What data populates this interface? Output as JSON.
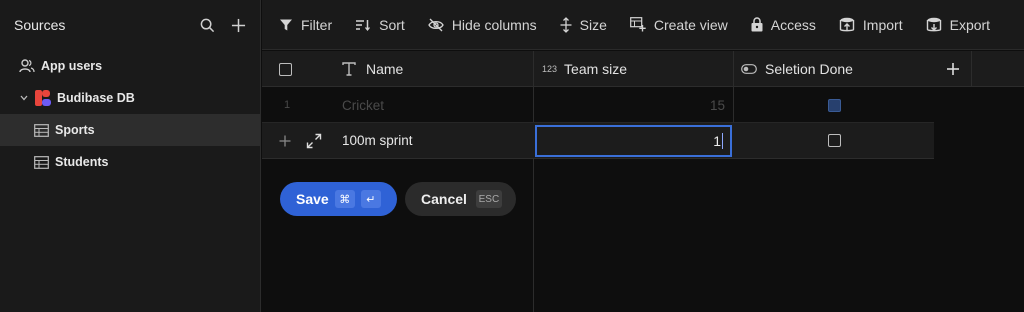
{
  "sidebar": {
    "title": "Sources",
    "items": [
      {
        "label": "App users",
        "icon": "users-icon"
      },
      {
        "label": "Budibase DB",
        "icon": "budibase-logo-icon"
      },
      {
        "label": "Sports",
        "icon": "table-icon"
      },
      {
        "label": "Students",
        "icon": "table-icon"
      }
    ]
  },
  "toolbar": {
    "filter": "Filter",
    "sort": "Sort",
    "hide_columns": "Hide columns",
    "size": "Size",
    "create_view": "Create view",
    "access": "Access",
    "import": "Import",
    "export": "Export"
  },
  "grid": {
    "columns": [
      {
        "label": "Name",
        "type_icon": "text-type-icon"
      },
      {
        "label": "Team size",
        "type_icon": "number-type-icon",
        "type_text": "123"
      },
      {
        "label": "Seletion Done",
        "type_icon": "toggle-type-icon"
      }
    ],
    "rows": [
      {
        "index": "1",
        "name": "Cricket",
        "team_size": "15",
        "selection_done": true
      },
      {
        "name": "100m sprint",
        "team_size": "1",
        "selection_done": false
      }
    ]
  },
  "actions": {
    "save_label": "Save",
    "save_kbd_1": "⌘",
    "save_kbd_2": "↵",
    "cancel_label": "Cancel",
    "cancel_kbd": "ESC"
  },
  "colors": {
    "accent": "#2f62d6",
    "background": "#0e0e0e",
    "sidebar": "#1a1a1a"
  }
}
